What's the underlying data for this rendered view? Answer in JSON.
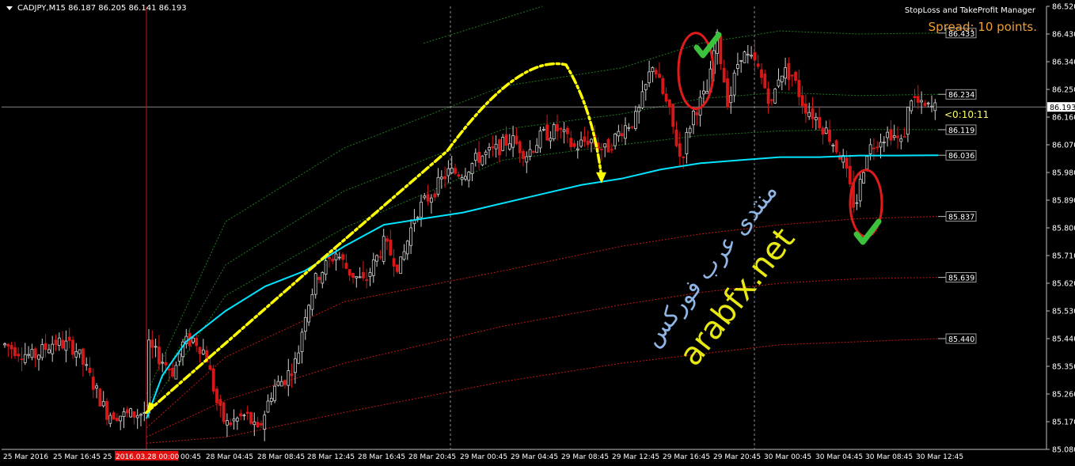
{
  "header": {
    "symbol_info": "CADJPY,M15  86.187 86.205 86.141 86.193"
  },
  "ea_label": "StopLoss and TakeProfit Manager",
  "spread_label": "Spread: 10 points.",
  "countdown": "<0:10:11",
  "watermark": {
    "arabic": "منتدى عرب فوركس",
    "site": "arabfx.net"
  },
  "colors": {
    "background": "#000000",
    "bull_candle": "#d0d0d0",
    "bear_candle": "#d81818",
    "ma_line": "#00e5ff",
    "arrow": "#ffff00",
    "upper_band": "#1f7a1f",
    "lower_band": "#c41818",
    "circle": "#e01b1b",
    "check": "#3cc13c",
    "date_highlight": "#e01010"
  },
  "chart_data": {
    "type": "candlestick",
    "symbol": "CADJPY",
    "timeframe": "M15",
    "ylim": [
      85.08,
      86.52
    ],
    "y_ticks": [
      "86.520",
      "86.430",
      "86.340",
      "86.250",
      "86.160",
      "86.070",
      "85.980",
      "85.890",
      "85.800",
      "85.710",
      "85.620",
      "85.530",
      "85.440",
      "85.350",
      "85.260",
      "85.170",
      "85.080"
    ],
    "current_price": "86.193",
    "level_labels": [
      "86.433",
      "86.234",
      "86.119",
      "86.036",
      "85.837",
      "85.639",
      "85.440"
    ],
    "x_labels": [
      "25 Mar 2016",
      "25 Mar 16:45",
      "25",
      "2016.03.28 00:00",
      "00:45",
      "28 Mar 04:45",
      "28 Mar 08:45",
      "28 Mar 12:45",
      "28 Mar 16:45",
      "28 Mar 20:45",
      "29 Mar 00:45",
      "29 Mar 04:45",
      "29 Mar 08:45",
      "29 Mar 12:45",
      "29 Mar 16:45",
      "29 Mar 20:45",
      "30 Mar 00:45",
      "30 Mar 04:45",
      "30 Mar 08:45",
      "30 Mar 12:45"
    ],
    "highlighted_date": "2016.03.28 00:00",
    "price_path": [
      [
        0,
        85.42
      ],
      [
        0.035,
        85.33
      ],
      [
        0.045,
        85.42
      ],
      [
        0.06,
        85.44
      ],
      [
        0.075,
        85.39
      ],
      [
        0.09,
        85.22
      ],
      [
        0.1,
        85.16
      ],
      [
        0.125,
        85.19
      ],
      [
        0.13,
        85.18
      ],
      [
        0.14,
        85.13
      ],
      [
        0.16,
        85.28
      ],
      [
        0.175,
        85.31
      ],
      [
        0.19,
        85.37
      ],
      [
        0.2,
        85.52
      ],
      [
        0.215,
        85.64
      ],
      [
        0.24,
        85.72
      ],
      [
        0.255,
        85.66
      ],
      [
        0.275,
        85.62
      ],
      [
        0.3,
        85.75
      ],
      [
        0.32,
        85.67
      ],
      [
        0.34,
        85.85
      ],
      [
        0.36,
        85.91
      ],
      [
        0.38,
        85.98
      ],
      [
        0.4,
        85.98
      ],
      [
        0.42,
        86.03
      ],
      [
        0.44,
        86.05
      ],
      [
        0.46,
        86.09
      ],
      [
        0.48,
        86.04
      ],
      [
        0.5,
        86.1
      ],
      [
        0.52,
        86.12
      ],
      [
        0.54,
        86.06
      ],
      [
        0.56,
        86.09
      ],
      [
        0.58,
        86.05
      ],
      [
        0.6,
        86.12
      ],
      [
        0.62,
        86.16
      ],
      [
        0.64,
        86.34
      ],
      [
        0.65,
        86.25
      ],
      [
        0.66,
        86.18
      ],
      [
        0.675,
        86.02
      ],
      [
        0.69,
        86.17
      ],
      [
        0.71,
        86.25
      ],
      [
        0.72,
        86.43
      ],
      [
        0.735,
        86.2
      ],
      [
        0.75,
        86.37
      ],
      [
        0.77,
        86.33
      ],
      [
        0.79,
        86.2
      ],
      [
        0.8,
        86.31
      ],
      [
        0.815,
        86.3
      ],
      [
        0.83,
        86.2
      ],
      [
        0.845,
        86.16
      ],
      [
        0.86,
        86.11
      ],
      [
        0.88,
        86.02
      ],
      [
        0.895,
        85.86
      ],
      [
        0.91,
        86.05
      ],
      [
        0.925,
        86.09
      ],
      [
        0.94,
        86.11
      ],
      [
        0.955,
        86.07
      ],
      [
        0.965,
        86.23
      ],
      [
        0.98,
        86.19
      ]
    ],
    "ma_path": [
      [
        0,
        85.18
      ],
      [
        0.02,
        85.32
      ],
      [
        0.05,
        85.43
      ],
      [
        0.1,
        85.53
      ],
      [
        0.15,
        85.61
      ],
      [
        0.2,
        85.66
      ],
      [
        0.25,
        85.74
      ],
      [
        0.3,
        85.81
      ],
      [
        0.35,
        85.83
      ],
      [
        0.4,
        85.85
      ],
      [
        0.45,
        85.88
      ],
      [
        0.5,
        85.91
      ],
      [
        0.55,
        85.94
      ],
      [
        0.6,
        85.96
      ],
      [
        0.65,
        85.99
      ],
      [
        0.7,
        86.01
      ],
      [
        0.75,
        86.02
      ],
      [
        0.8,
        86.03
      ],
      [
        0.85,
        86.03
      ],
      [
        0.9,
        86.035
      ],
      [
        0.95,
        86.035
      ],
      [
        1,
        86.036
      ]
    ],
    "upper_bands": [
      {
        "name": "upper-band-1",
        "values": [
          [
            0,
            85.26
          ],
          [
            0.1,
            85.82
          ],
          [
            0.25,
            86.06
          ],
          [
            0.45,
            86.26
          ],
          [
            0.6,
            86.32
          ],
          [
            0.7,
            86.4
          ],
          [
            0.8,
            86.44
          ],
          [
            0.9,
            86.43
          ],
          [
            1,
            86.433
          ]
        ]
      },
      {
        "name": "upper-band-2",
        "values": [
          [
            0,
            85.22
          ],
          [
            0.1,
            85.68
          ],
          [
            0.25,
            85.92
          ],
          [
            0.45,
            86.12
          ],
          [
            0.6,
            86.17
          ],
          [
            0.7,
            86.22
          ],
          [
            0.8,
            86.24
          ],
          [
            0.9,
            86.23
          ],
          [
            1,
            86.234
          ]
        ]
      },
      {
        "name": "upper-band-3",
        "values": [
          [
            0,
            85.2
          ],
          [
            0.1,
            85.58
          ],
          [
            0.25,
            85.8
          ],
          [
            0.45,
            86.02
          ],
          [
            0.6,
            86.07
          ],
          [
            0.7,
            86.1
          ],
          [
            0.8,
            86.115
          ],
          [
            0.9,
            86.12
          ],
          [
            1,
            86.119
          ]
        ]
      },
      {
        "name": "upper-band-4",
        "values": [
          [
            0.35,
            86.4
          ],
          [
            0.5,
            86.52
          ]
        ]
      }
    ],
    "lower_bands": [
      {
        "name": "lower-band-1",
        "values": [
          [
            0,
            85.15
          ],
          [
            0.1,
            85.38
          ],
          [
            0.25,
            85.56
          ],
          [
            0.45,
            85.66
          ],
          [
            0.6,
            85.74
          ],
          [
            0.7,
            85.78
          ],
          [
            0.8,
            85.81
          ],
          [
            0.9,
            85.83
          ],
          [
            1,
            85.837
          ]
        ]
      },
      {
        "name": "lower-band-2",
        "values": [
          [
            0,
            85.12
          ],
          [
            0.1,
            85.24
          ],
          [
            0.25,
            85.36
          ],
          [
            0.45,
            85.48
          ],
          [
            0.6,
            85.55
          ],
          [
            0.7,
            85.59
          ],
          [
            0.8,
            85.62
          ],
          [
            0.9,
            85.635
          ],
          [
            1,
            85.639
          ]
        ]
      },
      {
        "name": "lower-band-3",
        "values": [
          [
            0,
            85.1
          ],
          [
            0.1,
            85.12
          ],
          [
            0.25,
            85.2
          ],
          [
            0.45,
            85.3
          ],
          [
            0.6,
            85.36
          ],
          [
            0.7,
            85.39
          ],
          [
            0.8,
            85.42
          ],
          [
            0.9,
            85.43
          ],
          [
            1,
            85.44
          ]
        ]
      }
    ],
    "arrow_path": [
      [
        0.0,
        85.2
      ],
      [
        0.2,
        85.65
      ],
      [
        0.38,
        86.05
      ],
      [
        0.47,
        86.34
      ],
      [
        0.53,
        86.33
      ],
      [
        0.565,
        86.18
      ],
      [
        0.575,
        85.96
      ]
    ]
  }
}
